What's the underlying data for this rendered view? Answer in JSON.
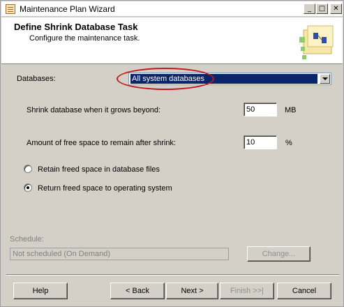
{
  "window": {
    "title": "Maintenance Plan Wizard",
    "min_glyph": "_",
    "max_glyph": "□",
    "close_glyph": "✕"
  },
  "header": {
    "title": "Define Shrink Database Task",
    "subtitle": "Configure the maintenance task."
  },
  "databases": {
    "label": "Databases:",
    "selected": "All system databases"
  },
  "shrink_threshold": {
    "label": "Shrink database when it grows beyond:",
    "value": "50",
    "unit": "MB"
  },
  "free_space": {
    "label": "Amount of free space to remain after shrink:",
    "value": "10",
    "unit": "%"
  },
  "free_space_option": {
    "retain_label": "Retain freed space in database files",
    "return_label": "Return freed space to operating system",
    "selected": "return"
  },
  "schedule": {
    "label": "Schedule:",
    "value": "Not scheduled (On Demand)",
    "change_button": "Change..."
  },
  "footer": {
    "help": "Help",
    "back": "< Back",
    "next": "Next >",
    "finish": "Finish >>|",
    "cancel": "Cancel"
  },
  "colors": {
    "selection": "#0a246a",
    "highlight_ellipse": "#c01818",
    "dialog_bg": "#d4d0c8"
  },
  "icons": {
    "app": "maintenance-plan-icon",
    "header_art": "wizard-graphic"
  }
}
